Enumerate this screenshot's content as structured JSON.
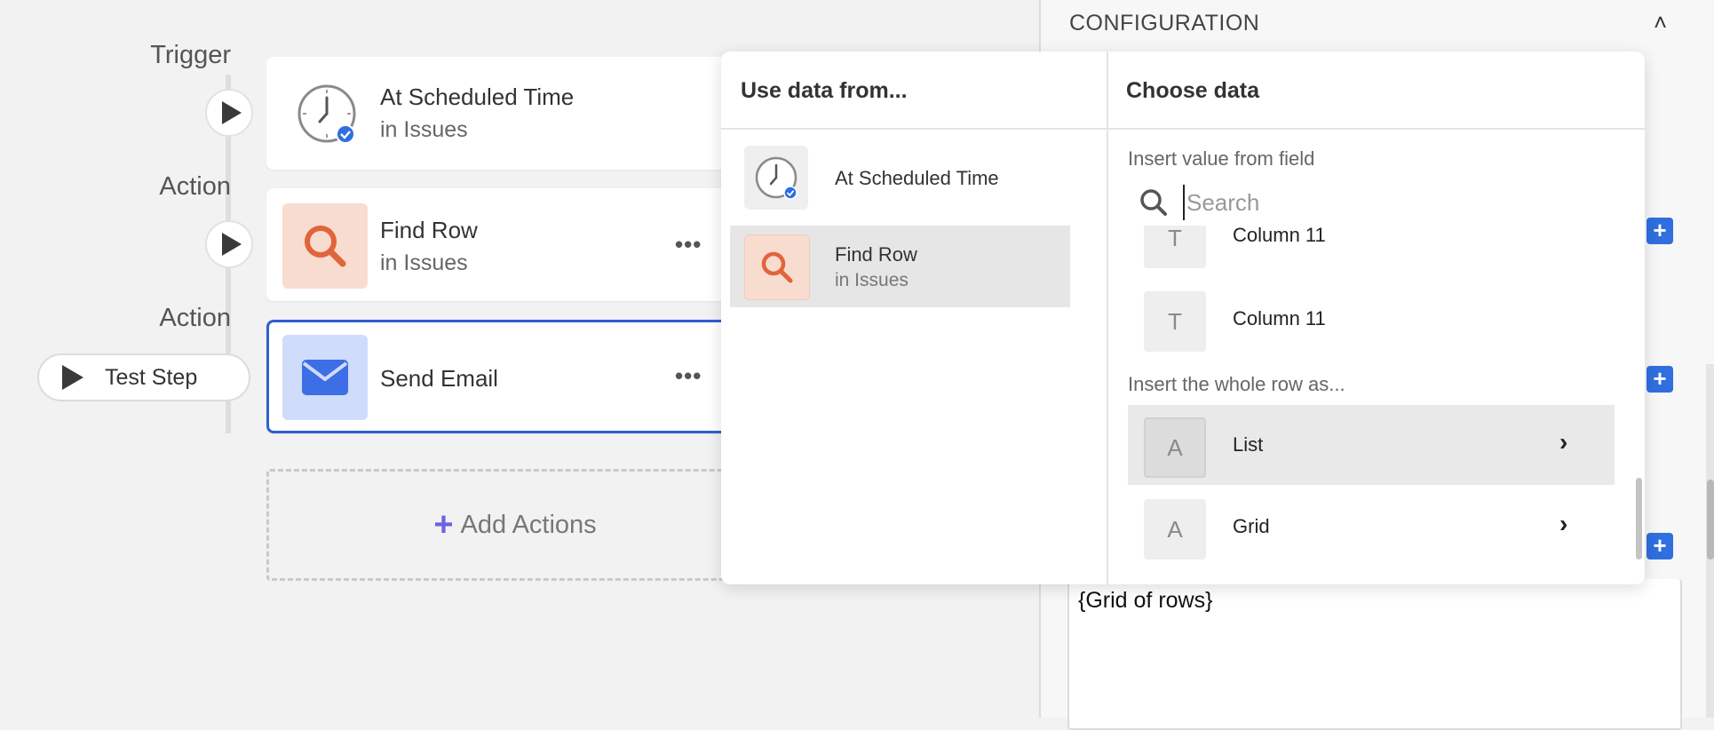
{
  "flow": {
    "steps": [
      {
        "kind": "Trigger",
        "title": "At Scheduled Time",
        "subtitle": "in Issues",
        "icon": "clock-icon"
      },
      {
        "kind": "Action",
        "title": "Find Row",
        "subtitle": "in Issues",
        "icon": "search-icon",
        "more": "•••"
      },
      {
        "kind": "Action",
        "title": "Send Email",
        "subtitle": "",
        "icon": "envelope-icon",
        "more": "•••"
      }
    ],
    "test_step_label": "Test Step",
    "add_actions_label": "Add Actions",
    "add_actions_plus": "+"
  },
  "config": {
    "title": "CONFIGURATION",
    "chevron": "˄",
    "plus_label": "+",
    "textarea_value": "{Grid of rows}"
  },
  "popover": {
    "left_heading": "Use data from...",
    "right_heading": "Choose data",
    "sources": [
      {
        "title": "At Scheduled Time",
        "subtitle": "",
        "icon": "clock-icon"
      },
      {
        "title": "Find Row",
        "subtitle": "in Issues",
        "icon": "search-icon"
      }
    ],
    "insert_field_label": "Insert value from field",
    "search_placeholder": "Search",
    "fields": [
      {
        "type_letter": "T",
        "label": "Column 11"
      },
      {
        "type_letter": "T",
        "label": "Column 11"
      }
    ],
    "whole_row_label": "Insert the whole row as...",
    "row_formats": [
      {
        "type_letter": "A",
        "label": "List",
        "chevron": "›"
      },
      {
        "type_letter": "A",
        "label": "Grid",
        "chevron": "›"
      }
    ]
  },
  "colors": {
    "accent_blue": "#2f5fd0",
    "search_orange": "#e0643c",
    "search_bg": "#f8dccf",
    "email_bg": "#cfdcfb",
    "email_blue": "#3d6ee6",
    "add_plus": "#6b63e6"
  }
}
